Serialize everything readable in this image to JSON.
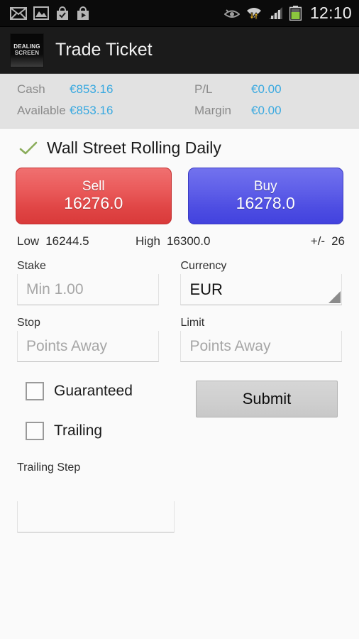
{
  "statusbar": {
    "left_icons": [
      "envelope-icon",
      "photo-icon",
      "bag-check-icon",
      "bag-play-icon"
    ],
    "right_icons": [
      "eye-icon",
      "wifi-transfer-icon",
      "signal-bars-icon",
      "battery-icon"
    ],
    "time": "12:10"
  },
  "actionbar": {
    "logo_line1": "DEALING",
    "logo_line2": "SCREEN",
    "title": "Trade Ticket"
  },
  "account": {
    "cash_label": "Cash",
    "cash_value": "€853.16",
    "pl_label": "P/L",
    "pl_value": "€0.00",
    "available_label": "Available",
    "available_value": "€853.16",
    "margin_label": "Margin",
    "margin_value": "€0.00",
    "value_color": "#3aa9e0"
  },
  "instrument": {
    "name": "Wall Street Rolling Daily",
    "status_icon": "check-icon",
    "check_color": "#8aac5a"
  },
  "quote": {
    "sell_label": "Sell",
    "sell_price": "16276.0",
    "buy_label": "Buy",
    "buy_price": "16278.0",
    "sell_color": "#e04545",
    "buy_color": "#4d4de2",
    "low_label": "Low",
    "low_value": "16244.5",
    "high_label": "High",
    "high_value": "16300.0",
    "spread_label": "+/-",
    "spread_value": "26"
  },
  "form": {
    "stake_label": "Stake",
    "stake_placeholder": "Min 1.00",
    "stake_value": "",
    "currency_label": "Currency",
    "currency_value": "EUR",
    "stop_label": "Stop",
    "stop_placeholder": "Points Away",
    "stop_value": "",
    "limit_label": "Limit",
    "limit_placeholder": "Points Away",
    "limit_value": "",
    "guaranteed_label": "Guaranteed",
    "guaranteed_checked": false,
    "trailing_label": "Trailing",
    "trailing_checked": false,
    "submit_label": "Submit",
    "trailing_step_label": "Trailing Step",
    "trailing_step_placeholder": "",
    "trailing_step_value": ""
  }
}
